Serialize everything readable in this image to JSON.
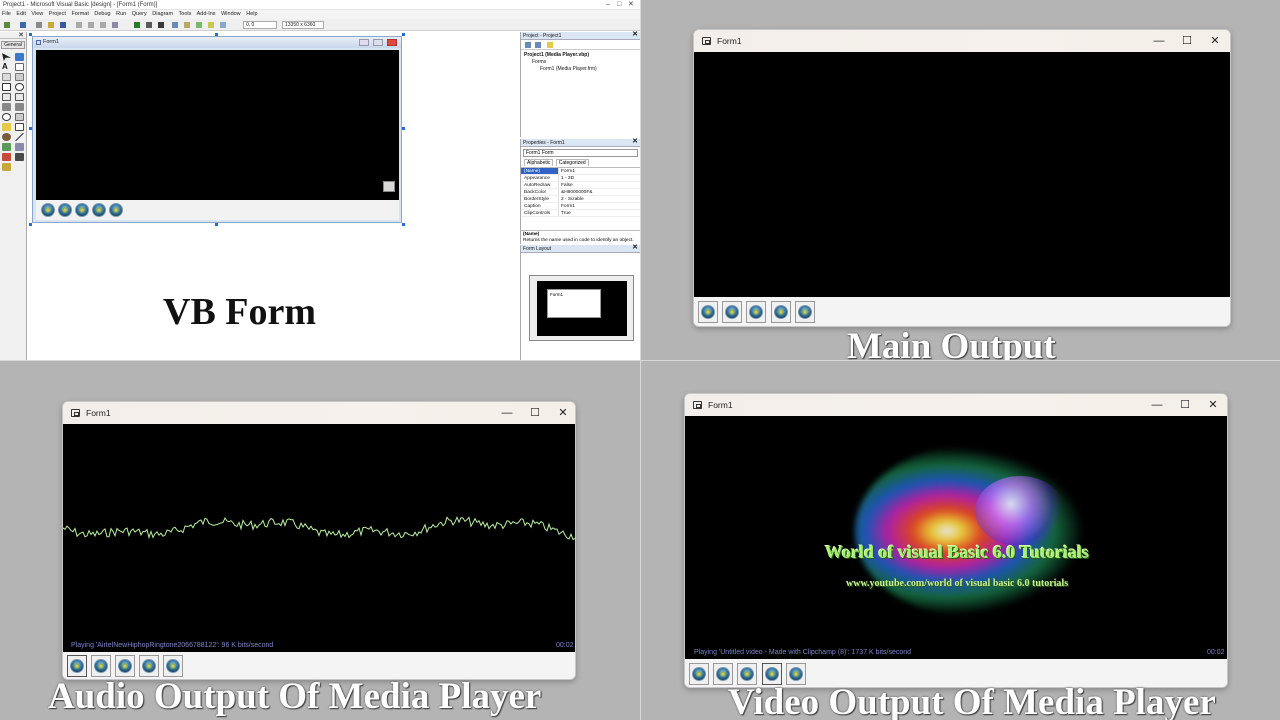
{
  "captions": {
    "vb_form": "VB Form",
    "main_output": "Main Output",
    "audio_output": "Audio Output Of Media Player",
    "video_output": "Video Output Of Media Player"
  },
  "ide": {
    "title": "Project1 - Microsoft Visual Basic [design] - [Form1 (Form)]",
    "menu": [
      "File",
      "Edit",
      "View",
      "Project",
      "Format",
      "Debug",
      "Run",
      "Query",
      "Diagram",
      "Tools",
      "Add-Ins",
      "Window",
      "Help"
    ],
    "toolbar": {
      "position": "0, 0",
      "size": "13350 x 6360"
    },
    "toolbox": {
      "tab": "General"
    },
    "designer_form": {
      "caption": "Form1"
    },
    "project_panel": {
      "title": "Project - Project1",
      "tree": [
        "Project1 (Media Player.vbp)",
        "Forms",
        "Form1 (Media Player.frm)"
      ]
    },
    "properties_panel": {
      "title": "Properties - Form1",
      "object": "Form1 Form",
      "tabs": [
        "Alphabetic",
        "Categorized"
      ],
      "rows": [
        {
          "name": "(Name)",
          "value": "Form1"
        },
        {
          "name": "Appearance",
          "value": "1 - 3D"
        },
        {
          "name": "AutoRedraw",
          "value": "False"
        },
        {
          "name": "BackColor",
          "value": "&H8000000F&"
        },
        {
          "name": "BorderStyle",
          "value": "2 - Sizable"
        },
        {
          "name": "Caption",
          "value": "Form1"
        },
        {
          "name": "ClipControls",
          "value": "True"
        }
      ],
      "desc_title": "(Name)",
      "desc_text": "Returns the name used in code to identify an object."
    },
    "layout_panel": {
      "title": "Form Layout",
      "form_label": "Form1"
    }
  },
  "windows": {
    "main": {
      "title": "Form1"
    },
    "audio": {
      "title": "Form1",
      "status": "Playing 'AirtelNewHiphopRingtone2066788122': 96 K bits/second",
      "time": "00:02"
    },
    "video": {
      "title": "Form1",
      "status": "Playing 'Untitled video - Made with Clipchamp (8)': 1737 K bits/second",
      "time": "00:02",
      "overlay_title": "World of visual Basic 6.0 Tutorials",
      "overlay_url": "www.youtube.com/world of visual basic 6.0 tutorials"
    }
  },
  "window_controls": {
    "minimize": "—",
    "maximize": "☐",
    "close": "✕"
  },
  "colors": {
    "status_text": "#7b86c8",
    "waveform": "#b8f0a0",
    "selection": "#2f64c4"
  }
}
